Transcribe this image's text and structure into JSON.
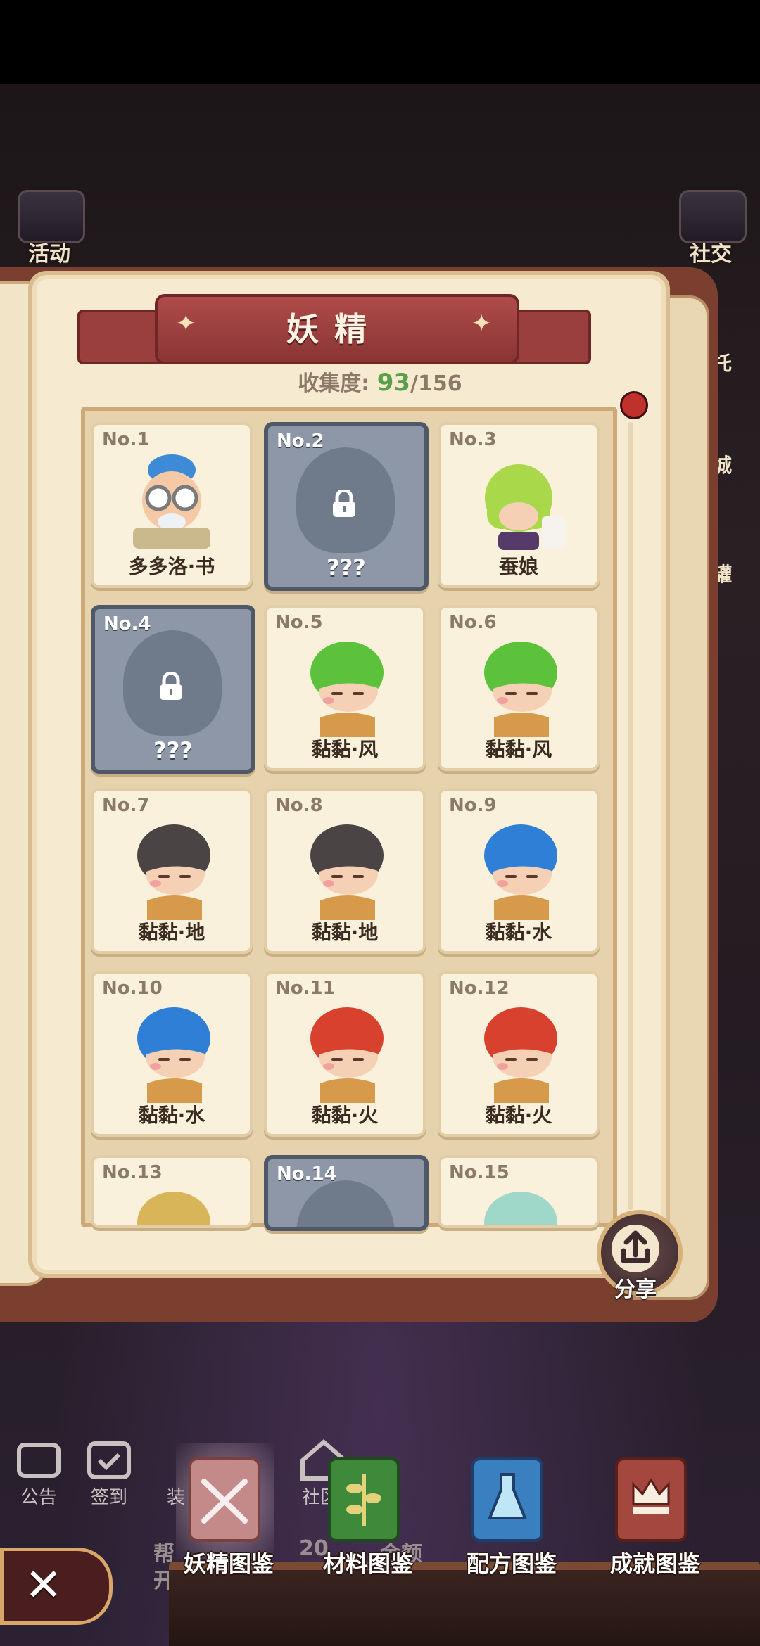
{
  "side": {
    "left_label": "活动",
    "right_label": "社交",
    "right_partial": [
      "托",
      "城",
      "罐"
    ]
  },
  "header": {
    "title": "妖精",
    "collect_label": "收集度:",
    "collected": "93",
    "total": "/156"
  },
  "cards": [
    {
      "no": "No.1",
      "name": "多多洛·书",
      "locked": false,
      "theme": "scholar"
    },
    {
      "no": "No.2",
      "name": "???",
      "locked": true
    },
    {
      "no": "No.3",
      "name": "蚕娘",
      "locked": false,
      "theme": "green-hair"
    },
    {
      "no": "No.4",
      "name": "???",
      "locked": true
    },
    {
      "no": "No.5",
      "name": "黏黏·风",
      "locked": false,
      "theme": "#5cc23c"
    },
    {
      "no": "No.6",
      "name": "黏黏·风",
      "locked": false,
      "theme": "#5cc23c"
    },
    {
      "no": "No.7",
      "name": "黏黏·地",
      "locked": false,
      "theme": "#4a4444"
    },
    {
      "no": "No.8",
      "name": "黏黏·地",
      "locked": false,
      "theme": "#4a4444"
    },
    {
      "no": "No.9",
      "name": "黏黏·水",
      "locked": false,
      "theme": "#2f7fd6"
    },
    {
      "no": "No.10",
      "name": "黏黏·水",
      "locked": false,
      "theme": "#2f7fd6"
    },
    {
      "no": "No.11",
      "name": "黏黏·火",
      "locked": false,
      "theme": "#d8412e"
    },
    {
      "no": "No.12",
      "name": "黏黏·火",
      "locked": false,
      "theme": "#d8412e"
    },
    {
      "no": "No.13",
      "name": "",
      "locked": false,
      "theme": "#d9b55a"
    },
    {
      "no": "No.14",
      "name": "",
      "locked": true
    },
    {
      "no": "No.15",
      "name": "",
      "locked": false,
      "theme": "#9fd8c8"
    }
  ],
  "share_label": "分享",
  "background_nav": [
    "公告",
    "签到",
    "装",
    "社区"
  ],
  "background_text": "20",
  "background_text_2": "金额",
  "background_text_3": "开",
  "background_text_4": "帮",
  "tabs": [
    {
      "label": "妖精图鉴",
      "active": true,
      "color": "#c98080"
    },
    {
      "label": "材料图鉴",
      "active": false,
      "color": "#3f8a3a"
    },
    {
      "label": "配方图鉴",
      "active": false,
      "color": "#3a7fc0"
    },
    {
      "label": "成就图鉴",
      "active": false,
      "color": "#a4473e"
    }
  ],
  "close_label": "✕",
  "colors": {
    "accent_red": "#9b3e3e",
    "count_green": "#5aa04a",
    "locked_card": "#8d97a7"
  }
}
